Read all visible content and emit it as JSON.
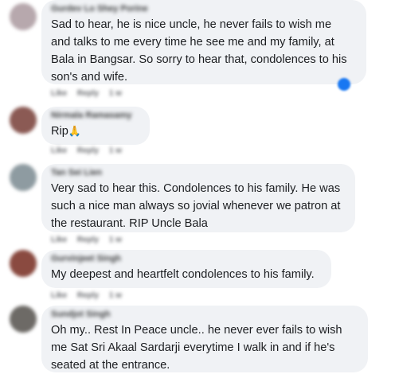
{
  "comments": [
    {
      "author": "Gurdev Lo Shey Porine",
      "text": "Sad to hear, he is nice uncle, he never fails to wish me\nand talks to me every time he see me and my family, at\nBala in Bangsar. So sorry to hear that, condolences to his\nson's and wife.",
      "actions": [
        "Like",
        "Reply",
        "1 w"
      ],
      "avatar_color": "#b7a8ad"
    },
    {
      "author": "Nirmala Ramasamy",
      "text": "Rip",
      "emoji": "🙏",
      "actions": [
        "Like",
        "Reply",
        "1 w"
      ],
      "avatar_color": "#8b5a54"
    },
    {
      "author": "Tan Sei Lien",
      "text": "Very sad to hear this. Condolences to his family. He was\nsuch a nice man always so jovial whenever we patron at\nthe restaurant. RIP Uncle Bala",
      "actions": [
        "Like",
        "Reply",
        "1 w"
      ],
      "avatar_color": "#8e9ba1"
    },
    {
      "author": "Gurvinjeet Singh",
      "text": "My deepest and heartfelt condolences to his family.",
      "actions": [
        "Like",
        "Reply",
        "1 w"
      ],
      "avatar_color": "#8a4a40"
    },
    {
      "author": "Sundjot Singh",
      "text": "Oh my.. Rest In Peace uncle.. he never ever fails to wish\nme Sat Sri Akaal Sardarji everytime I walk in and if he's\nseated at the entrance.",
      "actions": [
        "Like",
        "Reply",
        "1 w"
      ],
      "avatar_color": "#6d6a66"
    }
  ],
  "colors": {
    "bubble": "#f0f2f5",
    "text": "#1c1e21",
    "meta": "#65676b",
    "reaction": "#1877f2"
  }
}
